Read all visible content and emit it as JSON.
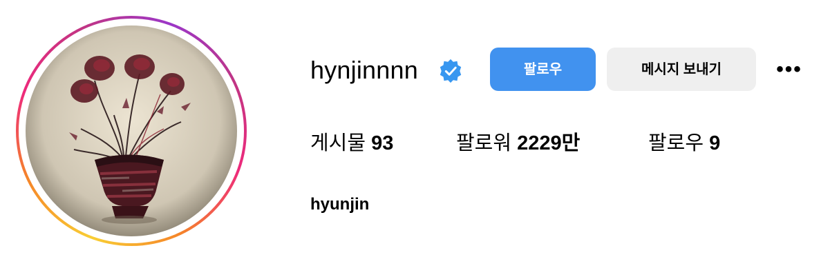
{
  "profile": {
    "username": "hynjinnnn",
    "verified_icon": "verified-badge-icon",
    "full_name": "hyunjin",
    "avatar_icon": "profile-photo"
  },
  "actions": {
    "follow_label": "팔로우",
    "message_label": "메시지 보내기",
    "more_label": "•••"
  },
  "stats": [
    {
      "label": "게시물",
      "value": "93"
    },
    {
      "label": "팔로워",
      "value": "2229만"
    },
    {
      "label": "팔로우",
      "value": "9"
    }
  ],
  "colors": {
    "follow_button": "#4192ef",
    "message_button": "#efefef",
    "verified_badge": "#3897f0"
  }
}
